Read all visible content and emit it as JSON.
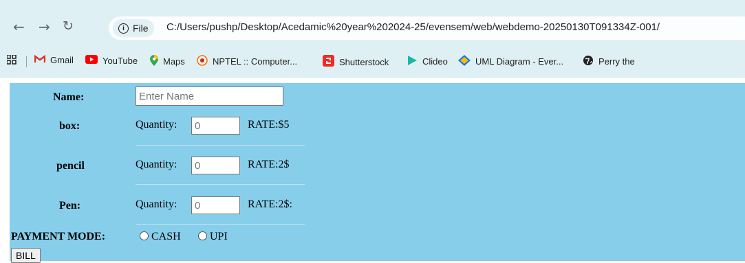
{
  "browser": {
    "url_chip": "File",
    "url": "C:/Users/pushp/Desktop/Acedamic%20year%202024-25/evensem/web/webdemo-20250130T091334Z-001/",
    "bookmarks": [
      {
        "label": "Gmail",
        "icon": "gmail-icon",
        "color": "#d93025"
      },
      {
        "label": "YouTube",
        "icon": "youtube-icon",
        "color": "#ff0000"
      },
      {
        "label": "Maps",
        "icon": "maps-icon",
        "color": "#34a853"
      },
      {
        "label": "NPTEL :: Computer...",
        "icon": "nptel-icon",
        "color": "#e8710a"
      },
      {
        "label": "Shutterstock",
        "icon": "shutterstock-icon",
        "color": "#ee2b24"
      },
      {
        "label": "Clideo",
        "icon": "clideo-icon",
        "color": "#19b9a8"
      },
      {
        "label": "UML Diagram - Ever...",
        "icon": "uml-icon",
        "color": "#1a73e8"
      },
      {
        "label": "Perry the",
        "icon": "globe-icon",
        "color": "#202124"
      }
    ]
  },
  "form": {
    "name_label": "Name:",
    "name_placeholder": "Enter Name",
    "items": [
      {
        "label": "box:",
        "quantity_label": "Quantity:",
        "quantity_value": "0",
        "rate": "RATE:$5"
      },
      {
        "label": "pencil",
        "quantity_label": "Quantity:",
        "quantity_value": "0",
        "rate": "RATE:2$"
      },
      {
        "label": "Pen:",
        "quantity_label": "Quantity:",
        "quantity_value": "0",
        "rate": "RATE:2$:"
      }
    ],
    "payment_label": "PAYMENT MODE:",
    "payment_options": [
      "CASH",
      "UPI"
    ],
    "bill_button": "BILL"
  },
  "colors": {
    "page_background": "#87ceeb",
    "chrome_background": "#dff0f4"
  }
}
